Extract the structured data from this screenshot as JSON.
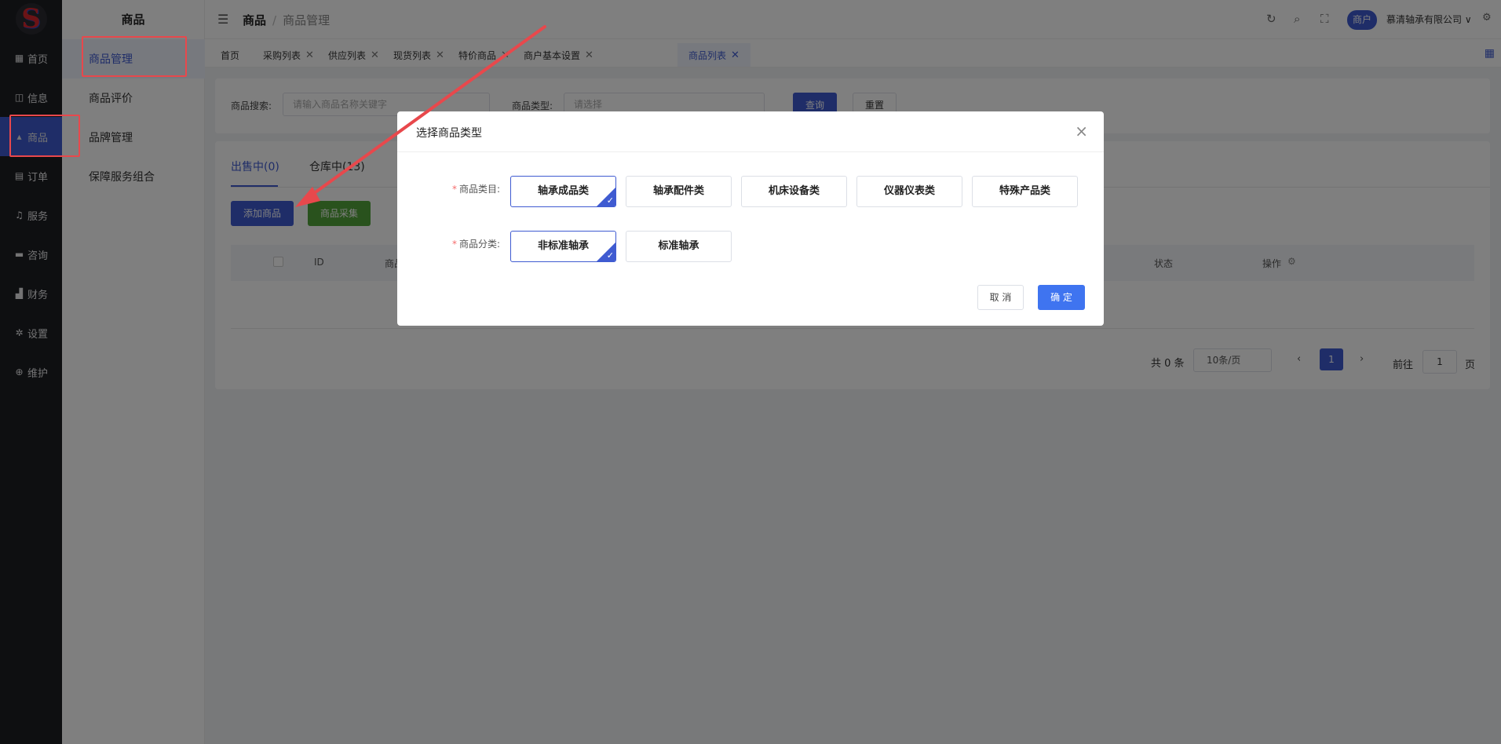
{
  "logo_letter": "S",
  "nav": {
    "items": [
      {
        "icon": "▦",
        "label": "首页"
      },
      {
        "icon": "◫",
        "label": "信息"
      },
      {
        "icon": "▴",
        "label": "商品"
      },
      {
        "icon": "▤",
        "label": "订单"
      },
      {
        "icon": "♫",
        "label": "服务"
      },
      {
        "icon": "▬",
        "label": "咨询"
      },
      {
        "icon": "▟",
        "label": "财务"
      },
      {
        "icon": "✲",
        "label": "设置"
      },
      {
        "icon": "⊕",
        "label": "维护"
      }
    ]
  },
  "subnav": {
    "title": "商品",
    "items": [
      "商品管理",
      "商品评价",
      "品牌管理",
      "保障服务组合"
    ]
  },
  "header": {
    "menu_icon": "☰",
    "crumb1": "商品",
    "sep": "/",
    "crumb2": "商品管理",
    "merchant_badge": "商户",
    "company": "慕清轴承有限公司 ∨",
    "icons": {
      "refresh": "↻",
      "search": "⌕",
      "fullscreen": "⛶",
      "settings": "⚙"
    }
  },
  "tabs": [
    {
      "label": "首页",
      "closable": false
    },
    {
      "label": "采购列表",
      "closable": true
    },
    {
      "label": "供应列表",
      "closable": true
    },
    {
      "label": "现货列表",
      "closable": true
    },
    {
      "label": "特价商品",
      "closable": true
    },
    {
      "label": "商户基本设置",
      "closable": true
    },
    {
      "label": "商品列表",
      "closable": true
    }
  ],
  "tab_close_glyph": "✕",
  "tabs_grid_icon": "▦",
  "search": {
    "keyword_label": "商品搜索:",
    "keyword_placeholder": "请输入商品名称关键字",
    "type_label": "商品类型:",
    "type_placeholder": "请选择",
    "query_btn": "查询",
    "reset_btn": "重置"
  },
  "list": {
    "tab_on_sale": "出售中(0)",
    "tab_warehouse": "仓库中(13)",
    "add_btn": "添加商品",
    "collect_btn": "商品采集",
    "col_id": "ID",
    "col_name": "商品",
    "col_status": "状态",
    "col_ops": "操作",
    "total": "共 0 条",
    "page_size": "10条/页",
    "current_page": "1",
    "goto_label": "前往",
    "goto_value": "1",
    "page_suffix": "页"
  },
  "dialog": {
    "title": "选择商品类型",
    "close_icon": "×",
    "category_label": "商品类目:",
    "categories": [
      "轴承成品类",
      "轴承配件类",
      "机床设备类",
      "仪器仪表类",
      "特殊产品类"
    ],
    "category_selected": 0,
    "class_label": "商品分类:",
    "classes": [
      "非标准轴承",
      "标准轴承"
    ],
    "class_selected": 0,
    "cancel_btn": "取 消",
    "confirm_btn": "确 定"
  },
  "colors": {
    "primary": "#3f5bd1",
    "success": "#52a43a",
    "annotation": "#e8484c",
    "nav_bg": "#1d1e23"
  }
}
